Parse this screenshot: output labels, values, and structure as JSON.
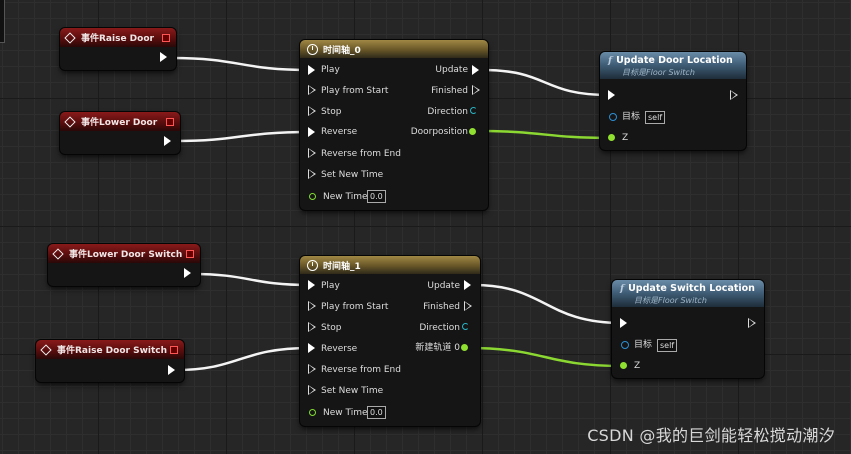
{
  "events": [
    {
      "id": "raise-door",
      "label": "事件Raise Door"
    },
    {
      "id": "lower-door",
      "label": "事件Lower Door"
    },
    {
      "id": "lower-door-switch",
      "label": "事件Lower Door Switch"
    },
    {
      "id": "raise-door-switch",
      "label": "事件Raise Door Switch"
    }
  ],
  "timelines": [
    {
      "title": "时间轴_0",
      "inputs": [
        "Play",
        "Play from Start",
        "Stop",
        "Reverse",
        "Reverse from End",
        "Set New Time",
        "New Time"
      ],
      "new_time_value": "0.0",
      "outputs": [
        "Update",
        "Finished",
        "Direction",
        "Doorposition"
      ]
    },
    {
      "title": "时间轴_1",
      "inputs": [
        "Play",
        "Play from Start",
        "Stop",
        "Reverse",
        "Reverse from End",
        "Set New Time",
        "New Time"
      ],
      "new_time_value": "0.0",
      "outputs": [
        "Update",
        "Finished",
        "Direction",
        "新建轨道 0"
      ]
    }
  ],
  "functions": [
    {
      "icon": "f",
      "title": "Update Door Location",
      "subtitle": "目标是Floor Switch",
      "target_label": "目标",
      "target_value": "self",
      "z_label": "Z"
    },
    {
      "icon": "f",
      "title": "Update Switch Location",
      "subtitle": "目标是Floor Switch",
      "target_label": "目标",
      "target_value": "self",
      "z_label": "Z"
    }
  ],
  "watermark": "CSDN @我的巨剑能轻松搅动潮汐",
  "colors": {
    "exec_wire": "#ffffff",
    "float_wire": "#8cd832",
    "event_header": "#8a1a1a",
    "timeline_header": "#a08844",
    "function_header": "#6a8ca8"
  }
}
